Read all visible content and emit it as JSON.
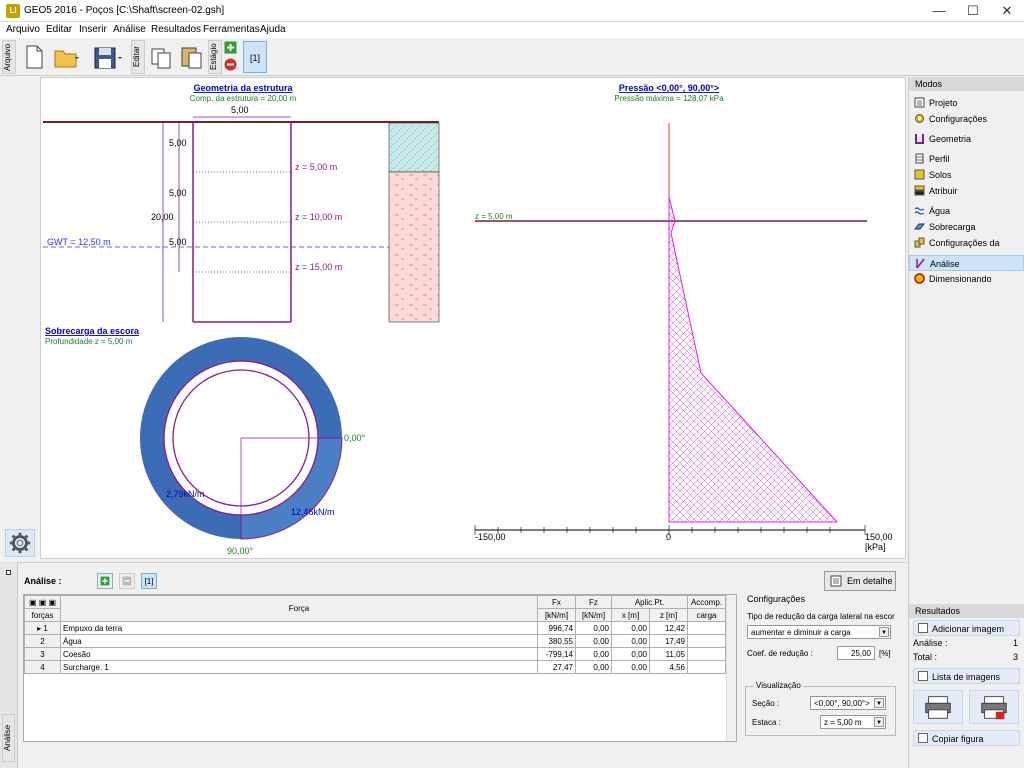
{
  "window": {
    "title": "GEO5 2016 - Poços [C:\\Shaft\\screen-02.gsh]",
    "app_icon": "GEO5 logo",
    "min": "—",
    "max": "☐",
    "close": "✕"
  },
  "menu": [
    "Arquivo",
    "Editar",
    "Inserir",
    "Análise",
    "Resultados",
    "Ferramentas",
    "Ajuda"
  ],
  "toolbar": {
    "arquivo_label": "Arquivo",
    "editar_label": "Editar",
    "estagio_label": "Estágio",
    "stage_value": "[1]"
  },
  "drawing": {
    "geom_title": "Geometria da estrutura",
    "geom_sub": "Comp. da estrutura = 20,00 m",
    "width_dim": "5,00",
    "dims": [
      "5,00",
      "5,00",
      "5,00",
      "5,00"
    ],
    "total_dim": "20,00",
    "z_labels": [
      "z = 5,00 m",
      "z = 10,00 m",
      "z = 15,00 m"
    ],
    "gwt": "GWT = 12,50 m",
    "surcharge_title": "Sobrecarga da escora",
    "surcharge_sub": "Profundidade z = 5,00 m",
    "angle0": "0,00°",
    "angle90": "90,00°",
    "load1": "2,79kN/m",
    "load2": "12,46kN/m",
    "press_title": "Pressão <0,00°, 90,00°>",
    "press_sub": "Pressão máxima = 128,07 kPa",
    "press_z": "z = 5,00 m",
    "axis_min": "-150,00",
    "axis_zero": "0",
    "axis_max": "150,00",
    "axis_unit": "[kPa]"
  },
  "modes": {
    "header": "Modos",
    "items": [
      {
        "label": "Projeto",
        "icon": "project-icon"
      },
      {
        "label": "Configurações",
        "icon": "settings-icon"
      },
      {
        "label": "Geometria",
        "icon": "geometry-icon"
      },
      {
        "label": "Perfil",
        "icon": "profile-icon"
      },
      {
        "label": "Solos",
        "icon": "soils-icon"
      },
      {
        "label": "Atribuir",
        "icon": "assign-icon"
      },
      {
        "label": "Água",
        "icon": "water-icon"
      },
      {
        "label": "Sobrecarga",
        "icon": "surcharge-icon"
      },
      {
        "label": "Configurações da etapa",
        "icon": "stage-settings-icon"
      },
      {
        "label": "Análise",
        "icon": "analysis-icon",
        "selected": true
      },
      {
        "label": "Dimensionando",
        "icon": "dimensioning-icon"
      }
    ]
  },
  "results": {
    "header": "Resultados",
    "add_image": "Adicionar imagem",
    "analysis_label": "Análise :",
    "analysis_value": "1",
    "total_label": "Total :",
    "total_value": "3",
    "list_images": "Lista de imagens",
    "copy_figure": "Copiar figura"
  },
  "analysis": {
    "label": "Análise :",
    "stage": "[1]",
    "detail_btn": "Em detalhe",
    "side_label": "Análise",
    "table": {
      "col_forces": "forças",
      "col_force": "Força",
      "col_fx": "Fx",
      "col_fz": "Fz",
      "col_fx_unit": "[kN/m]",
      "col_fz_unit": "[kN/m]",
      "col_aplic": "Aplic.Pt.",
      "col_x": "x [m]",
      "col_z": "z [m]",
      "col_accomp": "Accomp.",
      "col_carga": "carga",
      "rows": [
        {
          "n": "1",
          "name": "Empuxo da terra",
          "fx": "996,74",
          "fz": "0,00",
          "x": "0,00",
          "z": "12,42"
        },
        {
          "n": "2",
          "name": "Água",
          "fx": "380,55",
          "fz": "0,00",
          "x": "0,00",
          "z": "17,49"
        },
        {
          "n": "3",
          "name": "Coesão",
          "fx": "-799,14",
          "fz": "0,00",
          "x": "0,00",
          "z": "11,05"
        },
        {
          "n": "4",
          "name": "Surcharge. 1",
          "fx": "27,47",
          "fz": "0,00",
          "x": "0,00",
          "z": "4,56"
        }
      ]
    },
    "config": {
      "title": "Configurações",
      "reduction_label": "Tipo de redução da carga lateral na escor",
      "reduction_value": "aumentar e diminuir a carga",
      "coef_label": "Coef. de redução :",
      "coef_value": "25,00",
      "coef_unit": "[%]"
    },
    "visual": {
      "title": "Visualização",
      "section_label": "Seção :",
      "section_value": "<0,00°, 90,00°>",
      "stake_label": "Estaca :",
      "stake_value": "z = 5,00 m"
    }
  }
}
